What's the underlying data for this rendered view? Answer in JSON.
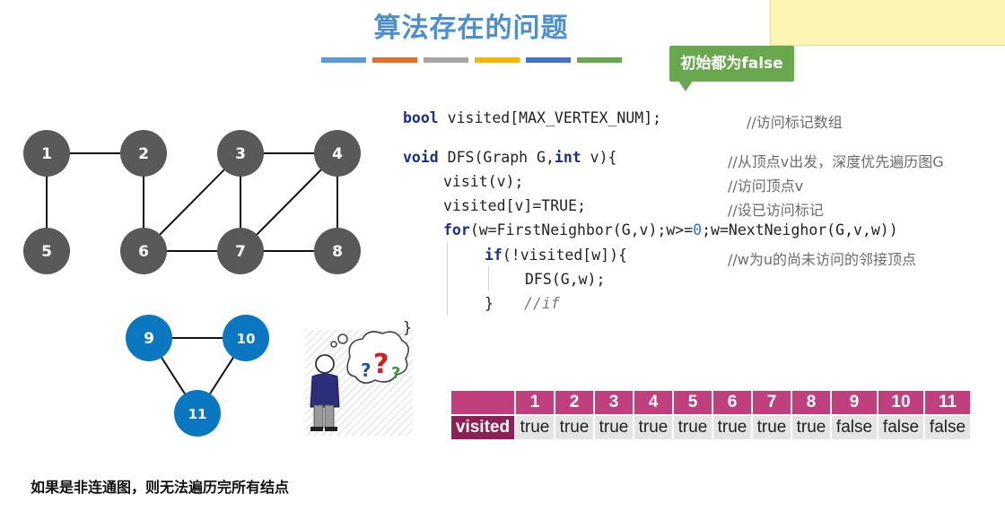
{
  "title": "算法存在的问题",
  "color_bars": [
    "#5b9bd5",
    "#e0702a",
    "#a6a6a6",
    "#f2b700",
    "#4472c4",
    "#6aa84f"
  ],
  "callout": "初始都为false",
  "graph": {
    "node_color_gray": "#595959",
    "node_color_blue": "#0b77c1",
    "nodes": [
      {
        "id": "1",
        "group": "gray"
      },
      {
        "id": "2",
        "group": "gray"
      },
      {
        "id": "3",
        "group": "gray"
      },
      {
        "id": "4",
        "group": "gray"
      },
      {
        "id": "5",
        "group": "gray"
      },
      {
        "id": "6",
        "group": "gray"
      },
      {
        "id": "7",
        "group": "gray"
      },
      {
        "id": "8",
        "group": "gray"
      },
      {
        "id": "9",
        "group": "blue"
      },
      {
        "id": "10",
        "group": "blue"
      },
      {
        "id": "11",
        "group": "blue"
      }
    ],
    "edges": [
      [
        "1",
        "2"
      ],
      [
        "1",
        "5"
      ],
      [
        "2",
        "6"
      ],
      [
        "3",
        "4"
      ],
      [
        "3",
        "6"
      ],
      [
        "3",
        "7"
      ],
      [
        "4",
        "7"
      ],
      [
        "4",
        "8"
      ],
      [
        "6",
        "7"
      ],
      [
        "7",
        "8"
      ],
      [
        "9",
        "10"
      ],
      [
        "9",
        "11"
      ],
      [
        "10",
        "11"
      ]
    ]
  },
  "code": {
    "decl_kw": "bool",
    "decl_rest": " visited[MAX_VERTEX_NUM];",
    "decl_comment": "//访问标记数组",
    "func_kw1": "void",
    "func_mid": " DFS(Graph G,",
    "func_kw2": "int",
    "func_end": " v){",
    "func_comment": "//从顶点v出发，深度优先遍历图G",
    "visit_line": "visit(v);",
    "visit_comment": "//访问顶点v",
    "set_line": "visited[v]=TRUE;",
    "set_comment": "//设已访问标记",
    "for_kw": "for",
    "for_a": "(w=FirstNeighbor(G,v);w>=",
    "for_num": "0",
    "for_b": ";w=NextNeighor(G,v,w))",
    "if_kw": "if",
    "if_rest": "(!visited[w]){",
    "if_comment": "//w为u的尚未访问的邻接顶点",
    "call_line": "DFS(G,w);",
    "close_if": "}",
    "close_if_comment": "//if",
    "close_func": "}"
  },
  "visited_table": {
    "row_label": "visited",
    "indices": [
      "1",
      "2",
      "3",
      "4",
      "5",
      "6",
      "7",
      "8",
      "9",
      "10",
      "11"
    ],
    "values": [
      "true",
      "true",
      "true",
      "true",
      "true",
      "true",
      "true",
      "true",
      "false",
      "false",
      "false"
    ]
  },
  "footer": "如果是非连通图，则无法遍历完所有结点"
}
